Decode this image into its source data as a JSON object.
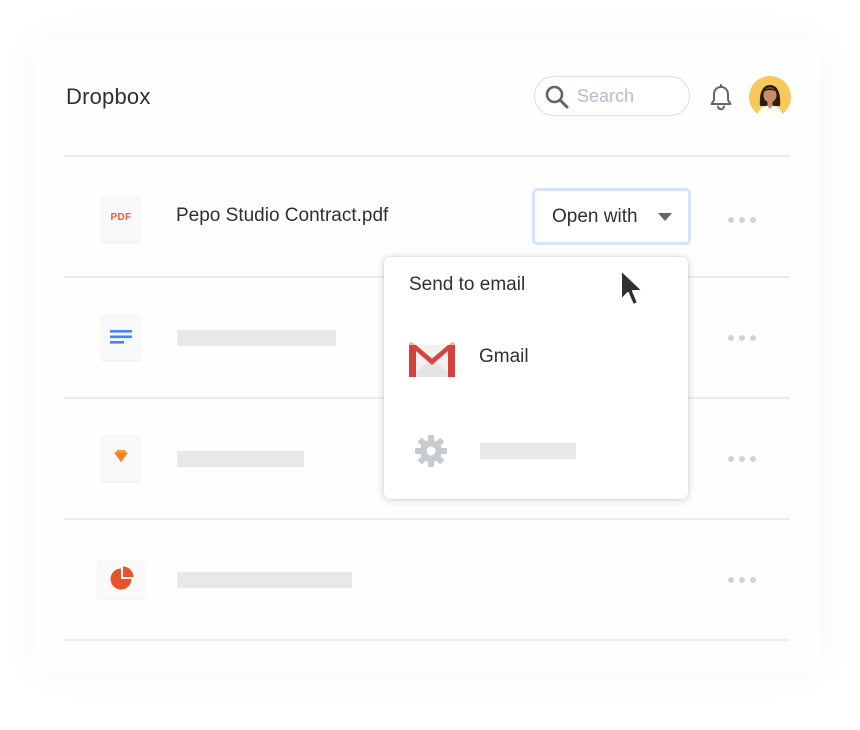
{
  "app": {
    "title": "Dropbox"
  },
  "search": {
    "placeholder": "Search",
    "icon": "search-icon"
  },
  "header": {
    "notification_icon": "bell-icon",
    "avatar_bg": "#f7c85a"
  },
  "files": [
    {
      "type": "pdf",
      "icon_label": "PDF",
      "name": "Pepo Studio Contract.pdf",
      "icon_color": "#e25c34"
    },
    {
      "type": "doc",
      "icon": "document-lines-icon",
      "icon_color": "#4285f4"
    },
    {
      "type": "sketch",
      "icon": "diamond-icon",
      "icon_color": "#f79a2b"
    },
    {
      "type": "presentation",
      "icon": "pie-chart-icon",
      "icon_color": "#e8542a"
    }
  ],
  "open_with": {
    "label": "Open with",
    "border_color": "#d5e4f8"
  },
  "menu": {
    "heading": "Send to email",
    "items": [
      {
        "label": "Gmail",
        "icon": "gmail-icon"
      },
      {
        "label": "",
        "icon": "gear-icon"
      }
    ]
  },
  "colors": {
    "text": "#2d3136",
    "divider": "#e9ebee",
    "placeholder": "#e8e8e8",
    "dots": "#cfd3d8"
  }
}
